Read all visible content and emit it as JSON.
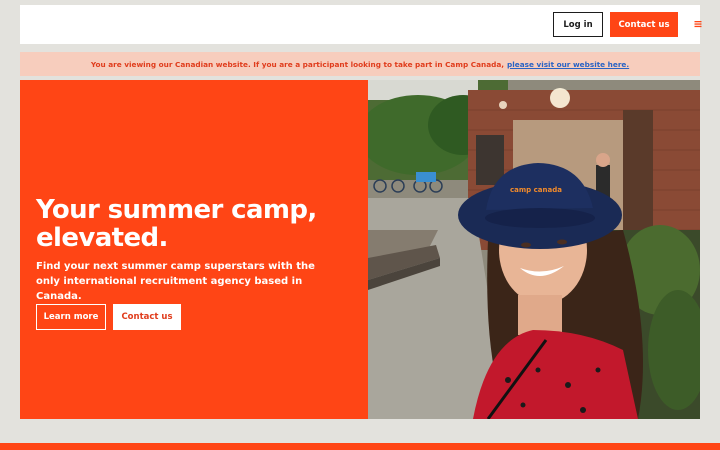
{
  "header": {
    "login_label": "Log in",
    "contact_label": "Contact us",
    "menu_icon": "hamburger-menu-icon"
  },
  "notice": {
    "text": "You are viewing our Canadian website. If you are a participant looking to take part in Camp Canada,",
    "link_text": "please visit our website here."
  },
  "hero": {
    "title_line1": "Your summer camp,",
    "title_line2": "elevated.",
    "subtitle": "Find your next summer camp superstars with the only international recruitment agency based in Canada.",
    "learn_more_label": "Learn more",
    "contact_label": "Contact us",
    "photo_hat_text": "camp canada"
  },
  "colors": {
    "accent": "#ff4515",
    "notice_bg": "#f7cdbd",
    "notice_text": "#e03c1c",
    "link": "#2a63c4",
    "page_bg": "#e3e2dd"
  }
}
